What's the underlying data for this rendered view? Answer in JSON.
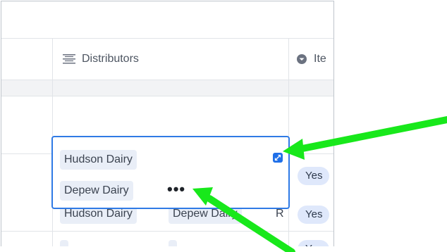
{
  "colors": {
    "accent_blue": "#2f7ae5",
    "tag_bg": "#e9eef7",
    "yes_bg": "#dfe8fb",
    "arrow_green": "#18e81b",
    "grid_line": "#e1e4e8",
    "group_band": "#f2f3f5"
  },
  "columns": {
    "distributors": {
      "label": "Distributors",
      "icon": "multiline-list-icon"
    },
    "next_column": {
      "label": "Ite",
      "icon": "circle-dropdown-icon"
    }
  },
  "popup": {
    "items": [
      {
        "label": "Hudson Dairy"
      },
      {
        "label": "Depew Dairy"
      }
    ],
    "more_label": "•••",
    "expand_icon": "expand-icon"
  },
  "rows": [
    {
      "tags": [
        "Hudson Dairy",
        "Depew Dairy",
        "R"
      ],
      "yes_label": "Yes"
    }
  ],
  "yes_values": [
    "Yes",
    "Yes",
    "Yes"
  ]
}
